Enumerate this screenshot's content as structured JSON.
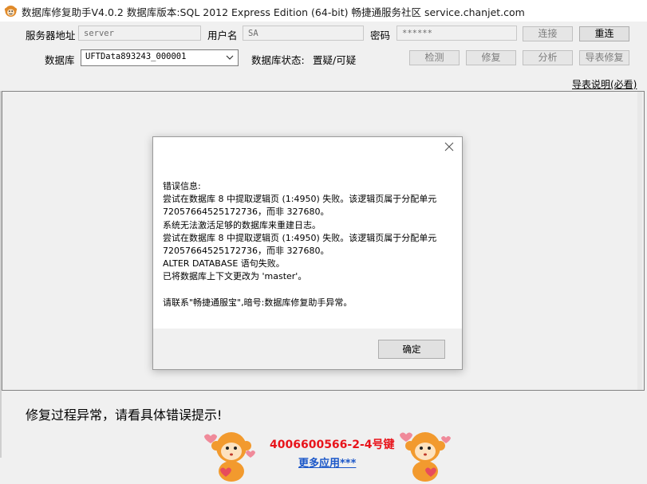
{
  "titlebar": {
    "title": "数据库修复助手V4.0.2 数据库版本:SQL 2012 Express Edition (64-bit)  畅捷通服务社区 service.chanjet.com"
  },
  "form": {
    "server_label": "服务器地址",
    "server_value": "server",
    "user_label": "用户名",
    "user_value": "SA",
    "password_label": "密码",
    "password_value": "******",
    "connect_label": "连接",
    "reconnect_label": "重连",
    "database_label": "数据库",
    "database_value": "UFTData893243_000001",
    "db_status_label": "数据库状态:",
    "db_status_value": "置疑/可疑",
    "detect_label": "检测",
    "repair_label": "修复",
    "analyze_label": "分析",
    "guide_repair_label": "导表修复"
  },
  "guide_link": "导表说明(必看)",
  "dialog": {
    "lines": [
      "错误信息:",
      "尝试在数据库 8 中提取逻辑页 (1:4950) 失败。该逻辑页属于分配单元",
      "72057664525172736，而非 327680。",
      "系统无法激活足够的数据库来重建日志。",
      "尝试在数据库 8 中提取逻辑页 (1:4950) 失败。该逻辑页属于分配单元",
      "72057664525172736，而非 327680。",
      "ALTER DATABASE 语句失败。",
      "已将数据库上下文更改为 'master'。",
      "",
      "请联系\"畅捷通服宝\",暗号:数据库修复助手异常。"
    ],
    "ok_label": "确定"
  },
  "status_message": "修复过程异常，请看具体错误提示!",
  "promo": {
    "phone": "4006600566-2-4号键",
    "more_apps": "更多应用***"
  },
  "colors": {
    "phone_red": "#e8141b",
    "link_blue": "#1a56c8",
    "mascot_orange": "#f29a2e"
  }
}
